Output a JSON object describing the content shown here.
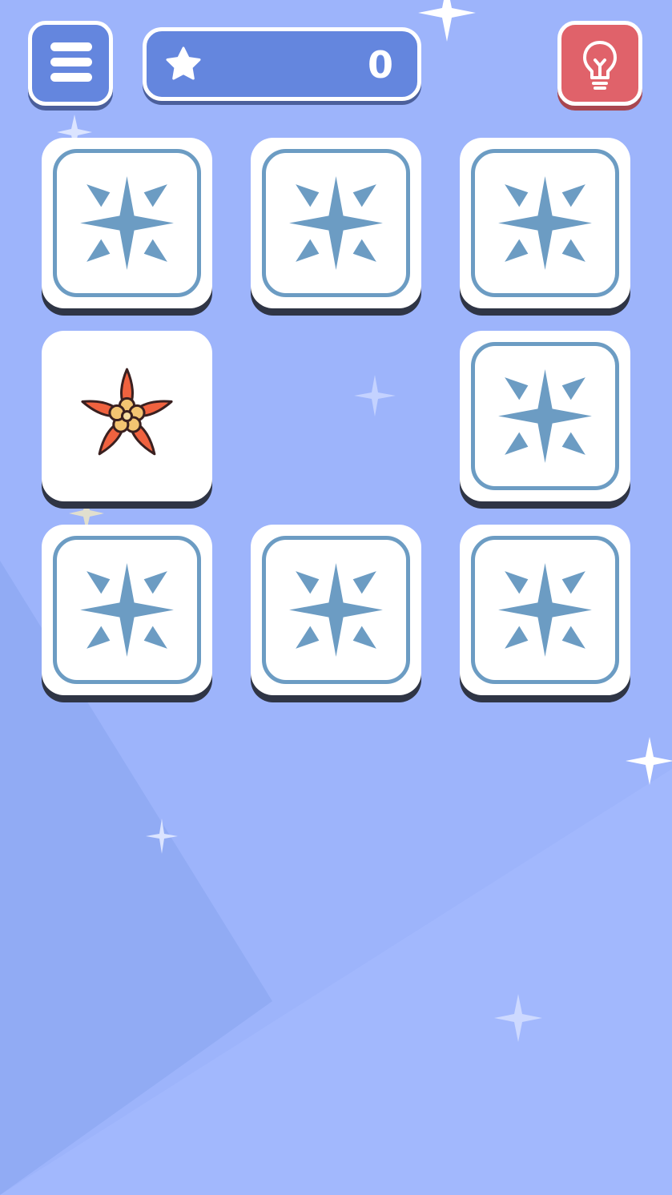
{
  "hud": {
    "score": "0",
    "menu_icon": "hamburger-menu-icon",
    "score_icon": "star-icon",
    "hint_icon": "lightbulb-icon"
  },
  "cards": [
    {
      "state": "face-down",
      "icon": "compass-star-icon"
    },
    {
      "state": "face-down",
      "icon": "compass-star-icon"
    },
    {
      "state": "face-down",
      "icon": "compass-star-icon"
    },
    {
      "state": "face-up",
      "icon": "flower-icon"
    },
    {
      "state": "matched-removed",
      "icon": ""
    },
    {
      "state": "face-down",
      "icon": "compass-star-icon"
    },
    {
      "state": "face-down",
      "icon": "compass-star-icon"
    },
    {
      "state": "face-down",
      "icon": "compass-star-icon"
    },
    {
      "state": "face-down",
      "icon": "compass-star-icon"
    }
  ],
  "colors": {
    "background": "#9db4fb",
    "hud_blue": "#6486de",
    "hint_red": "#e0626a",
    "card_face": "#ffffff",
    "card_back_symbol": "#6c9cc3",
    "flower_petal": "#f0623f",
    "flower_center": "#f3c472"
  }
}
